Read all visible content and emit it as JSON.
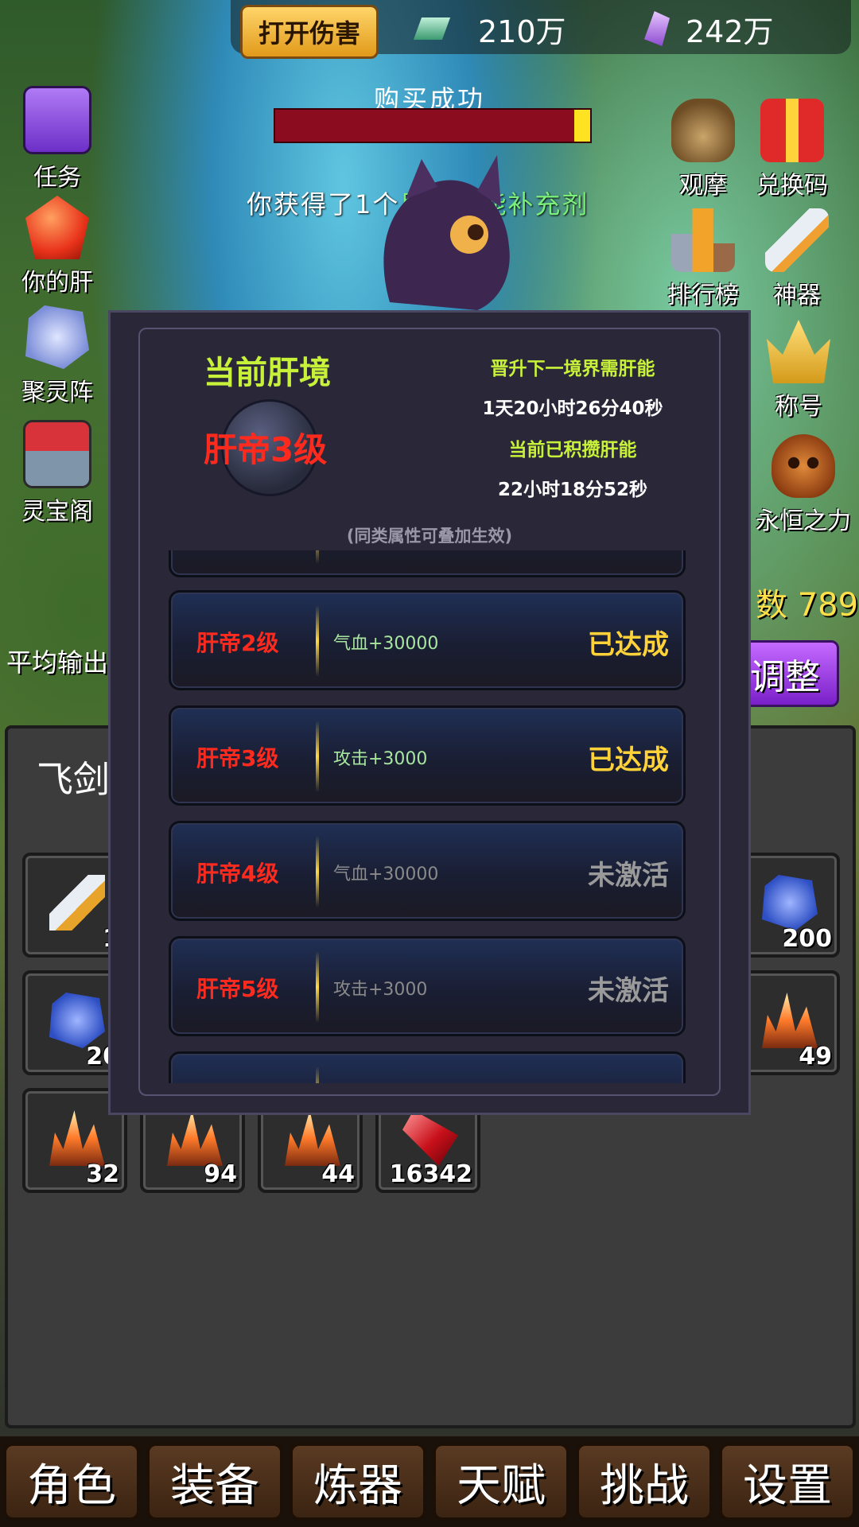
{
  "top": {
    "damage_button": "打开伤害",
    "currency_green": "210万",
    "currency_purple": "242万",
    "purchase_text": "购买成功",
    "reward_prefix": "你获得了1个",
    "reward_item": "巨型肝能补充剂"
  },
  "left_menu": [
    {
      "label": "任务",
      "icon": "book-icon"
    },
    {
      "label": "你的肝",
      "icon": "red-crystal-icon"
    },
    {
      "label": "聚灵阵",
      "icon": "rune-stone-icon"
    },
    {
      "label": "灵宝阁",
      "icon": "shop-icon"
    }
  ],
  "right_menu": [
    {
      "label": "观摩",
      "icon": "money-bag-icon"
    },
    {
      "label": "兑换码",
      "icon": "gift-icon"
    },
    {
      "label": "排行榜",
      "icon": "podium-icon"
    },
    {
      "label": "神器",
      "icon": "sword-icon"
    },
    {
      "label": "称号",
      "icon": "crown-icon"
    },
    {
      "label": "永恒之力",
      "icon": "skull-icon"
    }
  ],
  "stat_partial": "数 789",
  "avg_output_label": "平均输出",
  "adjust_button": "调整",
  "inventory": {
    "title": "飞剑",
    "slots": [
      {
        "count": "1",
        "icon": "sword-icon"
      },
      {
        "count": "200",
        "icon": "rune-stone-icon"
      },
      {
        "count": "20",
        "icon": "rune-stone-icon"
      },
      {
        "count": "49",
        "icon": "crystal-cluster-icon"
      },
      {
        "count": "32",
        "icon": "crystal-cluster-icon"
      },
      {
        "count": "94",
        "icon": "crystal-cluster-icon"
      },
      {
        "count": "44",
        "icon": "crystal-cluster-icon"
      },
      {
        "count": "16342",
        "icon": "red-gem-icon"
      }
    ]
  },
  "modal": {
    "title": "当前肝境",
    "current_level": "肝帝3级",
    "next_label": "晋升下一境界需肝能",
    "next_value": "1天20小时26分40秒",
    "accum_label": "当前已积攒肝能",
    "accum_value": "22小时18分52秒",
    "note": "(同类属性可叠加生效)",
    "rows": [
      {
        "level": "肝帝2级",
        "attr": "气血+30000",
        "status": "已达成",
        "achieved": true
      },
      {
        "level": "肝帝3级",
        "attr": "攻击+3000",
        "status": "已达成",
        "achieved": true
      },
      {
        "level": "肝帝4级",
        "attr": "气血+30000",
        "status": "未激活",
        "achieved": false
      },
      {
        "level": "肝帝5级",
        "attr": "攻击+3000",
        "status": "未激活",
        "achieved": false
      }
    ]
  },
  "nav": [
    "角色",
    "装备",
    "炼器",
    "天赋",
    "挑战",
    "设置"
  ],
  "colors": {
    "achieved": "#ffd23a",
    "inactive": "#9a9a9a",
    "attr_active": "#a8e6a0",
    "attr_inactive": "#8a8a8a",
    "level_red": "#ff2a1e"
  }
}
